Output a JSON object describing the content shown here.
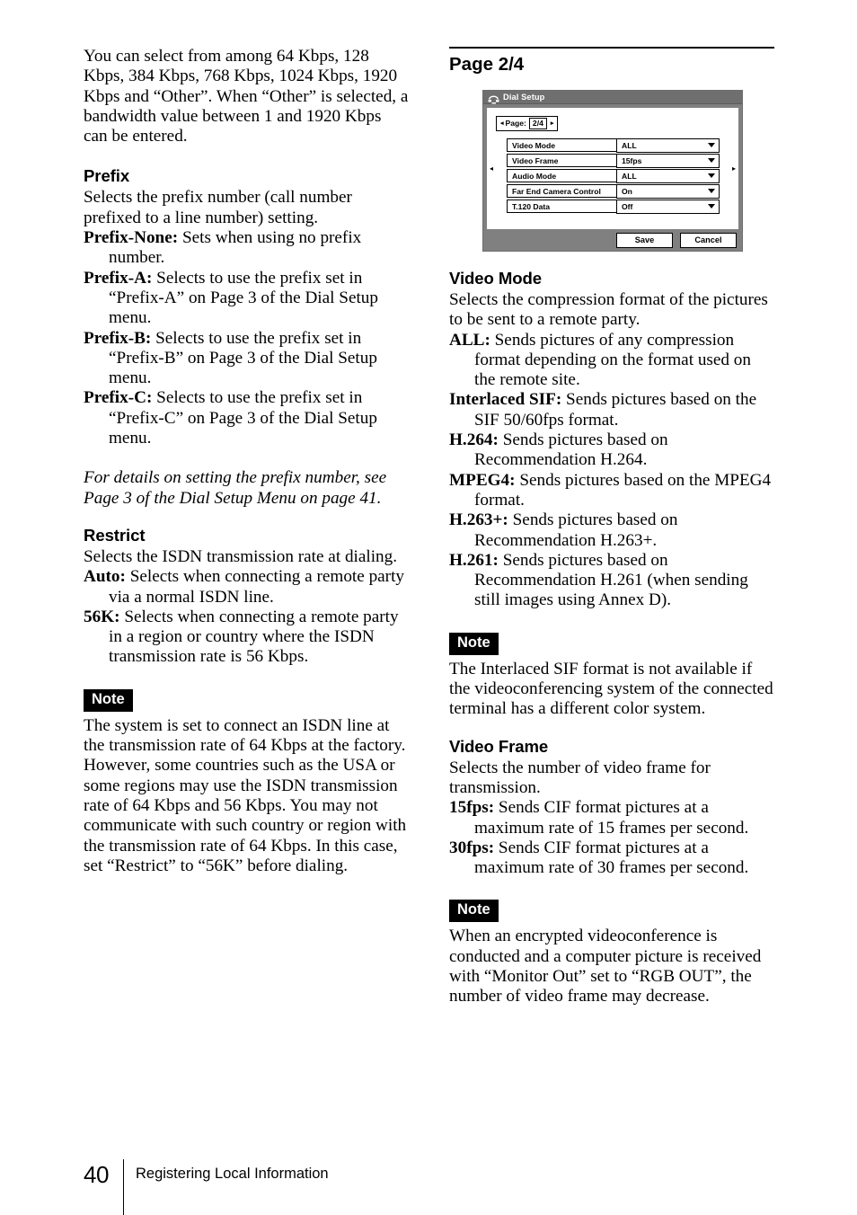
{
  "document": {
    "page_number": "40",
    "footer_title": "Registering Local Information"
  },
  "left_column": {
    "intro_paragraph": "You can select from among 64 Kbps, 128 Kbps, 384 Kbps, 768 Kbps, 1024 Kbps, 1920 Kbps and “Other”. When “Other” is selected, a bandwidth value between 1 and 1920 Kbps can be entered.",
    "prefix": {
      "heading": "Prefix",
      "description": "Selects the prefix number (call number prefixed to a line number) setting.",
      "items": [
        {
          "term": "Prefix-None:",
          "definition": " Sets when using no prefix number."
        },
        {
          "term": "Prefix-A:",
          "definition": " Selects to use the prefix set in “Prefix-A” on Page 3 of the Dial Setup menu."
        },
        {
          "term": "Prefix-B:",
          "definition": " Selects to use the prefix set in “Prefix-B” on Page 3 of the Dial Setup menu."
        },
        {
          "term": "Prefix-C:",
          "definition": " Selects to use the prefix set in “Prefix-C” on Page 3 of the Dial Setup menu."
        }
      ],
      "cross_reference": "For details on setting the prefix number, see Page 3 of the Dial Setup Menu on page 41."
    },
    "restrict": {
      "heading": "Restrict",
      "description": "Selects the ISDN transmission rate at dialing.",
      "items": [
        {
          "term": "Auto:",
          "definition": " Selects when connecting a remote party via a normal ISDN line."
        },
        {
          "term": "56K:",
          "definition": " Selects when connecting a remote party in a region or country where the ISDN transmission rate is 56 Kbps."
        }
      ]
    },
    "note": {
      "badge": "Note",
      "text": "The system is set to connect an ISDN line at the transmission rate of 64 Kbps at the factory. However, some countries such as the USA or some regions may use the ISDN transmission rate of 64 Kbps and 56 Kbps. You may not communicate with such country or region with the transmission rate of 64 Kbps. In this case, set “Restrict” to “56K” before dialing."
    }
  },
  "right_column": {
    "page_heading": "Page 2/4",
    "dialog": {
      "icon": "telephone-icon",
      "title": "Dial Setup",
      "page_nav": {
        "prev_arrow": "◂",
        "label": "Page:",
        "value": "2/4",
        "next_arrow": "▸"
      },
      "left_arrow": "◂",
      "right_arrow": "▸",
      "rows": [
        {
          "label": "Video Mode",
          "value": "ALL"
        },
        {
          "label": "Video Frame",
          "value": "15fps"
        },
        {
          "label": "Audio Mode",
          "value": "ALL"
        },
        {
          "label": "Far End Camera Control",
          "value": "On"
        },
        {
          "label": "T.120 Data",
          "value": "Off"
        }
      ],
      "buttons": {
        "save": "Save",
        "cancel": "Cancel"
      },
      "colors": {
        "titlebar": "#6f6f6f",
        "frame": "#808080",
        "panel": "#ffffff"
      }
    },
    "video_mode": {
      "heading": "Video Mode",
      "description": "Selects the compression format of the pictures to be sent to a remote party.",
      "items": [
        {
          "term": "ALL:",
          "definition": " Sends pictures of any compression format depending on the format used on the remote site."
        },
        {
          "term": "Interlaced SIF:",
          "definition": " Sends pictures based on the SIF 50/60fps format."
        },
        {
          "term": "H.264:",
          "definition": " Sends pictures based on Recommendation H.264."
        },
        {
          "term": "MPEG4:",
          "definition": " Sends pictures based on the MPEG4 format."
        },
        {
          "term": "H.263+:",
          "definition": " Sends pictures based on Recommendation H.263+."
        },
        {
          "term": "H.261:",
          "definition": " Sends pictures based on Recommendation H.261 (when sending still images using Annex D)."
        }
      ]
    },
    "note_1": {
      "badge": "Note",
      "text": "The Interlaced SIF format is not available if the videoconferencing system of the connected terminal has a different color system."
    },
    "video_frame": {
      "heading": "Video Frame",
      "description": "Selects the number of video frame for transmission.",
      "items": [
        {
          "term": "15fps:",
          "definition": " Sends CIF format pictures at a maximum rate of 15 frames per second."
        },
        {
          "term": "30fps:",
          "definition": " Sends CIF format pictures at a maximum rate of 30 frames per second."
        }
      ]
    },
    "note_2": {
      "badge": "Note",
      "text": "When an encrypted videoconference is conducted and a computer picture is received with “Monitor Out” set to “RGB OUT”, the number of video frame may decrease."
    }
  }
}
